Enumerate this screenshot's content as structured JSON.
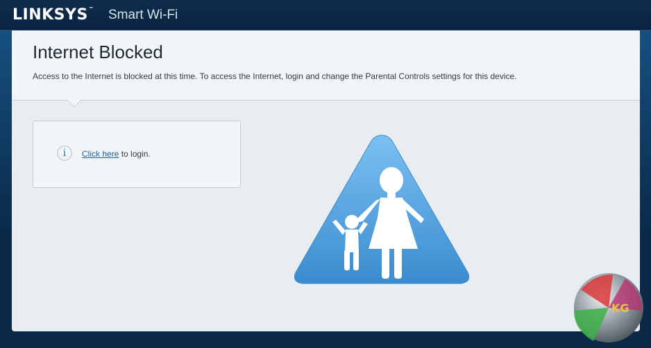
{
  "header": {
    "brand": "LINKSYS",
    "trademark": "™",
    "product": "Smart Wi-Fi"
  },
  "main": {
    "title": "Internet Blocked",
    "description": "Access to the Internet is blocked at this time. To access the Internet, login and change the Parental Controls settings for this device.",
    "login": {
      "link_text": "Click here",
      "suffix_text": " to login."
    },
    "info_icon_glyph": "i"
  },
  "sign": {
    "icon": "parental-controls-sign-icon",
    "color_top": "#7cc0f2",
    "color_bottom": "#3a8ccf"
  },
  "watermark": {
    "text": "KG"
  }
}
